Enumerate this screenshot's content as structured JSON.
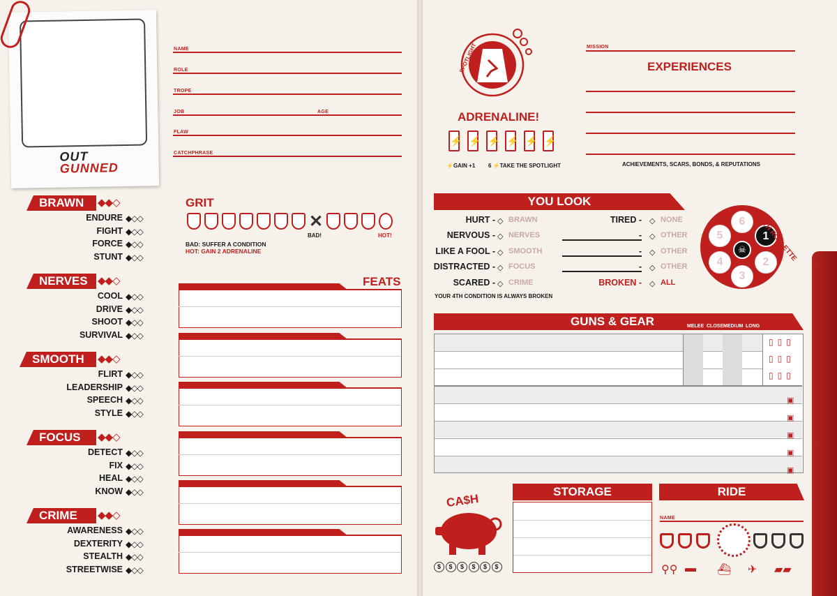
{
  "logo": {
    "line1": "OUT",
    "line2": "GUNNED"
  },
  "character_fields": {
    "name": "NAME",
    "role": "ROLE",
    "trope": "TROPE",
    "job": "JOB",
    "age": "AGE",
    "flaw": "FLAW",
    "catchphrase": "CATCHPHRASE"
  },
  "attributes": [
    {
      "name": "BRAWN",
      "skills": [
        "ENDURE",
        "FIGHT",
        "FORCE",
        "STUNT"
      ]
    },
    {
      "name": "NERVES",
      "skills": [
        "COOL",
        "DRIVE",
        "SHOOT",
        "SURVIVAL"
      ]
    },
    {
      "name": "SMOOTH",
      "skills": [
        "FLIRT",
        "LEADERSHIP",
        "SPEECH",
        "STYLE"
      ]
    },
    {
      "name": "FOCUS",
      "skills": [
        "DETECT",
        "FIX",
        "HEAL",
        "KNOW"
      ]
    },
    {
      "name": "CRIME",
      "skills": [
        "AWARENESS",
        "DEXTERITY",
        "STEALTH",
        "STREETWISE"
      ]
    }
  ],
  "attr_dots": "◆◆◇",
  "skill_dots": "◆◇◇",
  "grit": {
    "title": "GRIT",
    "bad_label": "BAD!",
    "hot_label": "HOT!",
    "rule1": "BAD: SUFFER A CONDITION",
    "rule2": "HOT: GAIN 2 ADRENALINE"
  },
  "feats": {
    "title": "FEATS"
  },
  "spotlight": {
    "label": "SPOTLIGHT",
    "adrenaline": "ADRENALINE!",
    "gain": "⚡GAIN +1",
    "take": "6 ⚡TAKE THE SPOTLIGHT"
  },
  "mission": {
    "label": "MISSION",
    "experiences": "EXPERIENCES",
    "caption": "ACHIEVEMENTS, SCARS, BONDS, & REPUTATIONS"
  },
  "you_look": {
    "title": "YOU LOOK",
    "left": [
      {
        "label": "HURT -",
        "opt": "BRAWN"
      },
      {
        "label": "NERVOUS -",
        "opt": "NERVES"
      },
      {
        "label": "LIKE A FOOL -",
        "opt": "SMOOTH"
      },
      {
        "label": "DISTRACTED -",
        "opt": "FOCUS"
      },
      {
        "label": "SCARED -",
        "opt": "CRIME"
      }
    ],
    "right": [
      {
        "label": "TIRED -",
        "opt": "NONE"
      },
      {
        "label": "-",
        "opt": "OTHER"
      },
      {
        "label": "-",
        "opt": "OTHER"
      },
      {
        "label": "-",
        "opt": "OTHER"
      },
      {
        "label": "BROKEN -",
        "opt": "ALL"
      }
    ],
    "note": "YOUR 4TH CONDITION IS ALWAYS BROKEN"
  },
  "death_roulette": {
    "title": "DEATH ROULETTE",
    "chambers": [
      "1",
      "2",
      "3",
      "4",
      "5",
      "6"
    ]
  },
  "guns_gear": {
    "title": "GUNS & GEAR",
    "cols": [
      "MELEE",
      "CLOSE",
      "MEDIUM",
      "LONG"
    ]
  },
  "cash": {
    "title": "CA$H",
    "coins": [
      "$",
      "$",
      "$",
      "$",
      "$",
      "$"
    ]
  },
  "storage": {
    "title": "STORAGE"
  },
  "ride": {
    "title": "RIDE",
    "name_label": "NAME"
  },
  "colors": {
    "accent": "#c0201d",
    "paper": "#f6f1ea"
  }
}
